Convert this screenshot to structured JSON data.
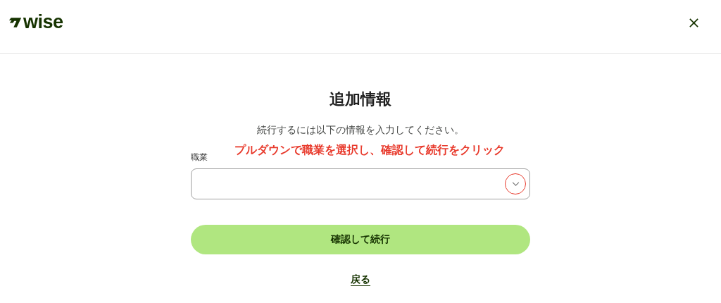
{
  "header": {
    "logo": "wise"
  },
  "form": {
    "title": "追加情報",
    "subtitle": "続行するには以下の情報を入力してください。",
    "field_label": "職業",
    "annotation": "プルダウンで職業を選択し、確認して続行をクリック",
    "annotation_circle": true,
    "submit": "確認して続行",
    "back": "戻る"
  }
}
